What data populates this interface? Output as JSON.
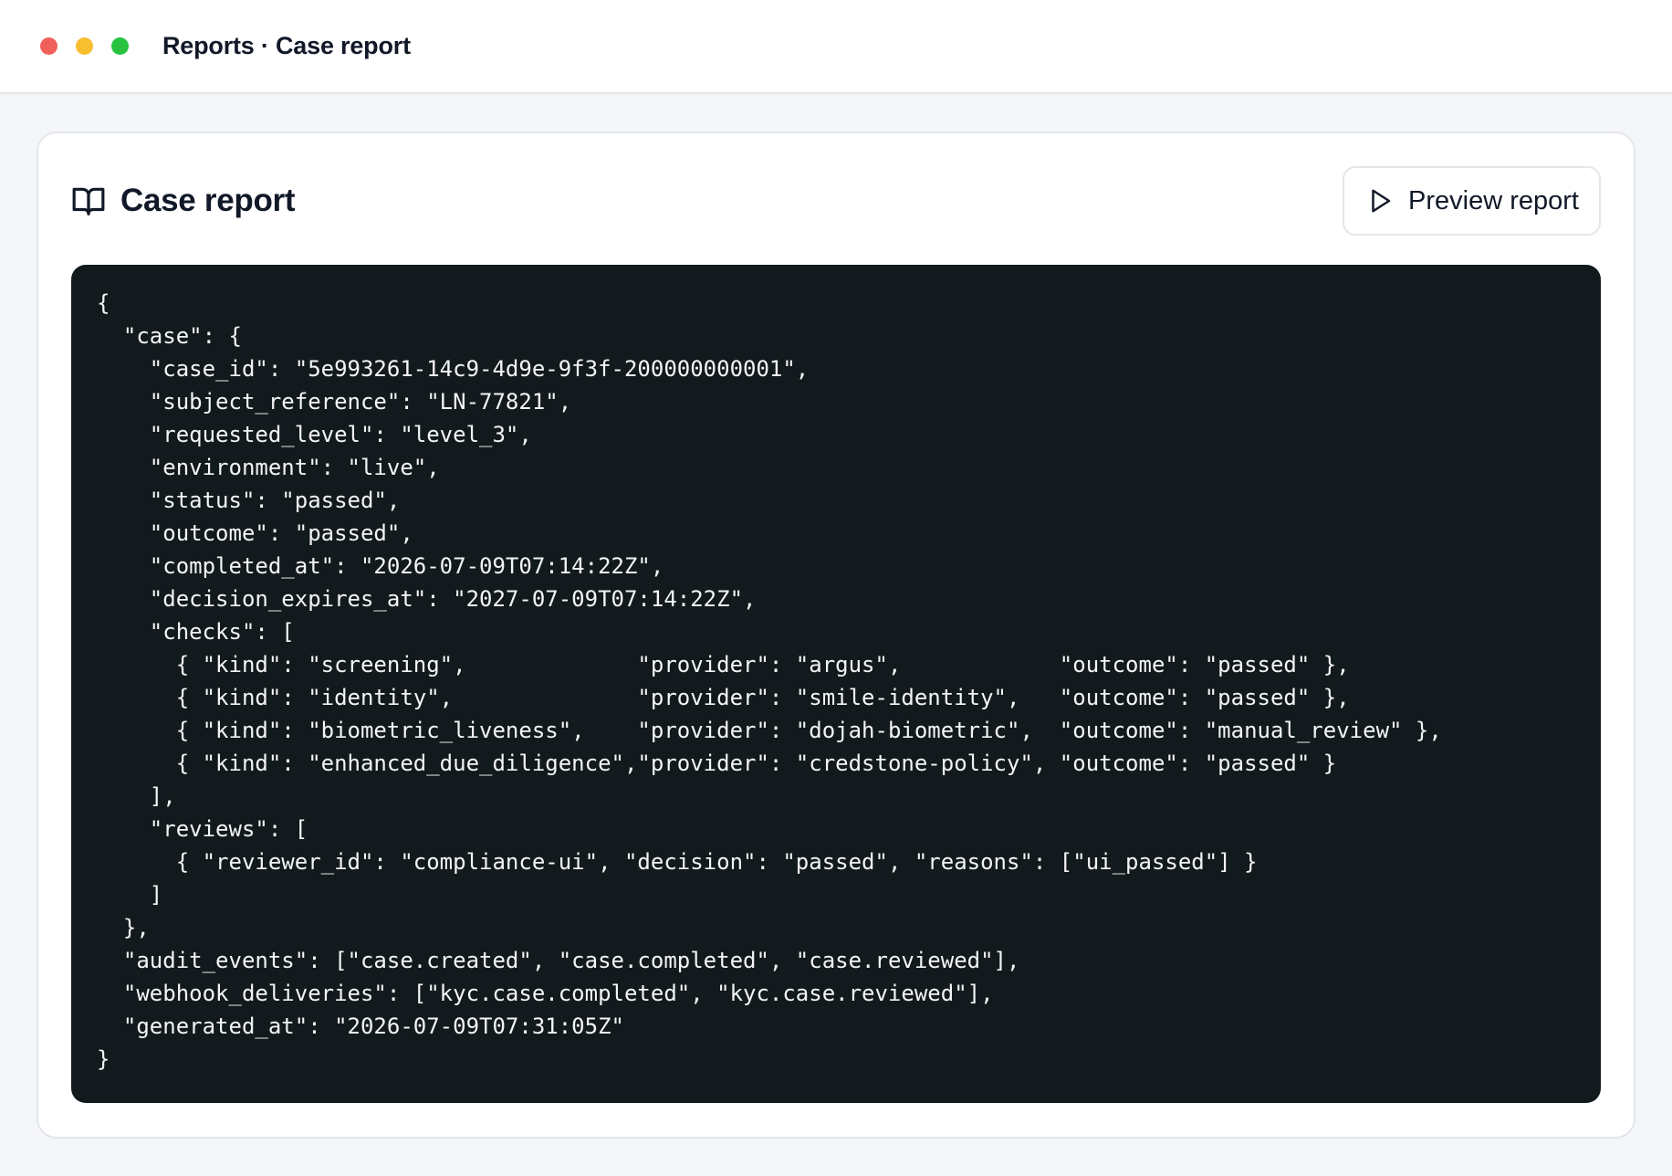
{
  "window": {
    "title": "Reports · Case report"
  },
  "card": {
    "title": "Case report",
    "icon": "book-open-icon",
    "preview_button_label": "Preview report",
    "preview_button_icon": "play-icon"
  },
  "report_json": "{\n  \"case\": {\n    \"case_id\": \"5e993261-14c9-4d9e-9f3f-200000000001\",\n    \"subject_reference\": \"LN-77821\",\n    \"requested_level\": \"level_3\",\n    \"environment\": \"live\",\n    \"status\": \"passed\",\n    \"outcome\": \"passed\",\n    \"completed_at\": \"2026-07-09T07:14:22Z\",\n    \"decision_expires_at\": \"2027-07-09T07:14:22Z\",\n    \"checks\": [\n      { \"kind\": \"screening\",             \"provider\": \"argus\",            \"outcome\": \"passed\" },\n      { \"kind\": \"identity\",              \"provider\": \"smile-identity\",   \"outcome\": \"passed\" },\n      { \"kind\": \"biometric_liveness\",    \"provider\": \"dojah-biometric\",  \"outcome\": \"manual_review\" },\n      { \"kind\": \"enhanced_due_diligence\",\"provider\": \"credstone-policy\", \"outcome\": \"passed\" }\n    ],\n    \"reviews\": [\n      { \"reviewer_id\": \"compliance-ui\", \"decision\": \"passed\", \"reasons\": [\"ui_passed\"] }\n    ]\n  },\n  \"audit_events\": [\"case.created\", \"case.completed\", \"case.reviewed\"],\n  \"webhook_deliveries\": [\"kyc.case.completed\", \"kyc.case.reviewed\"],\n  \"generated_at\": \"2026-07-09T07:31:05Z\"\n}",
  "colors": {
    "close": "#f0605a",
    "minimize": "#f7be30",
    "maximize": "#27c33f",
    "code_background": "#131a1d",
    "code_text": "#f3f4f6"
  }
}
